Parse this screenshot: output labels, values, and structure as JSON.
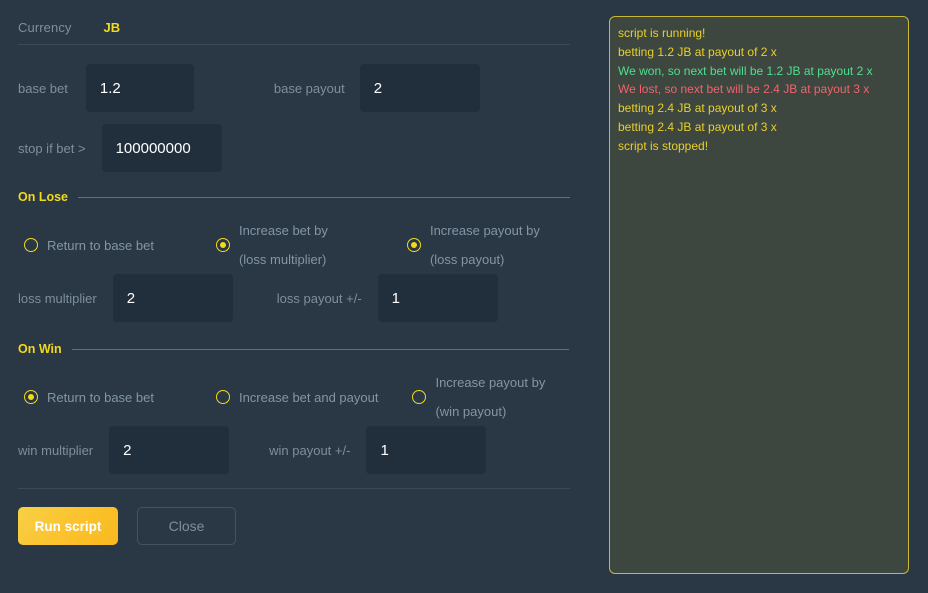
{
  "currency": {
    "label": "Currency",
    "value": "JB"
  },
  "fields": {
    "base_bet": {
      "label": "base bet",
      "value": "1.2"
    },
    "base_payout": {
      "label": "base payout",
      "value": "2"
    },
    "stop_if_bet": {
      "label": "stop if bet >",
      "value": "100000000"
    },
    "loss_multiplier": {
      "label": "loss multiplier",
      "value": "2"
    },
    "loss_payout": {
      "label": "loss payout +/-",
      "value": "1"
    },
    "win_multiplier": {
      "label": "win multiplier",
      "value": "2"
    },
    "win_payout": {
      "label": "win payout +/-",
      "value": "1"
    }
  },
  "on_lose": {
    "heading": "On Lose",
    "options": [
      {
        "label": "Return to base bet",
        "checked": false
      },
      {
        "label": "Increase bet by (loss multiplier)",
        "checked": true
      },
      {
        "label": "Increase payout by (loss payout)",
        "checked": true
      }
    ]
  },
  "on_win": {
    "heading": "On Win",
    "options": [
      {
        "label": "Return to base bet",
        "checked": true
      },
      {
        "label": "Increase bet and payout",
        "checked": false
      },
      {
        "label": "Increase payout by (win payout)",
        "checked": false
      }
    ]
  },
  "buttons": {
    "run": "Run script",
    "close": "Close"
  },
  "console_log": [
    {
      "text": "script is running!",
      "type": "info"
    },
    {
      "text": "betting 1.2 JB at payout of 2 x",
      "type": "info"
    },
    {
      "text": "We won, so next bet will be 1.2 JB at payout 2 x",
      "type": "win"
    },
    {
      "text": "We lost, so next bet will be 2.4 JB at payout 3 x",
      "type": "lose"
    },
    {
      "text": "betting 2.4 JB at payout of 3 x",
      "type": "info"
    },
    {
      "text": "betting 2.4 JB at payout of 3 x",
      "type": "info"
    },
    {
      "text": "script is stopped!",
      "type": "info"
    }
  ],
  "colors": {
    "accent": "#f2d91c",
    "background": "#2a3744",
    "input_background": "#212e3c",
    "console_background": "#3d473f",
    "log_info": "#e9cf2b",
    "log_win": "#4fdf8f",
    "log_lose": "#f4626c"
  }
}
